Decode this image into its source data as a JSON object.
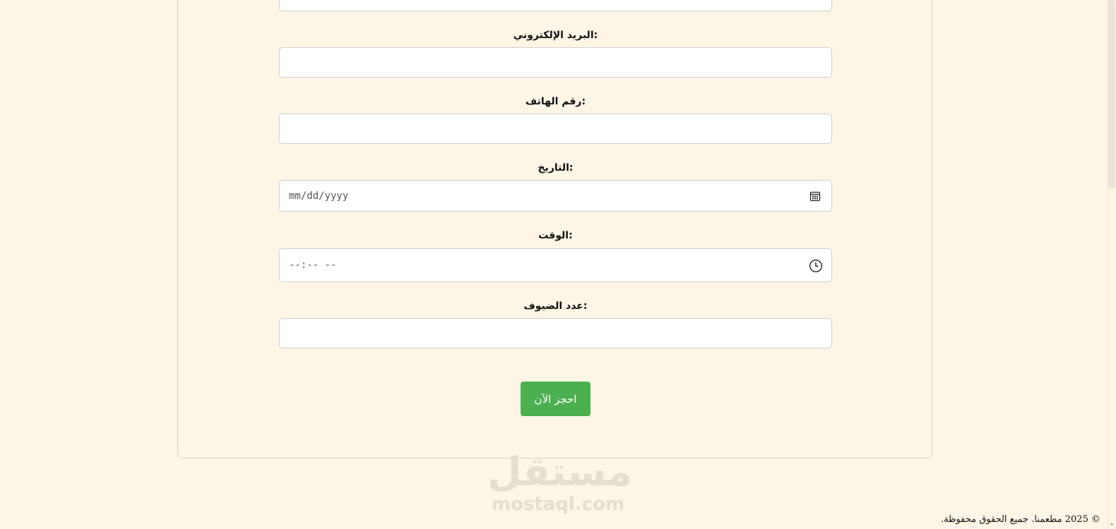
{
  "form": {
    "fields": [
      {
        "label": "البريد الإلكتروني:",
        "value": ""
      },
      {
        "label": "رقم الهاتف:",
        "value": ""
      },
      {
        "label": "التاريخ:",
        "value": "mm/dd/yyyy"
      },
      {
        "label": "الوقت:",
        "value": "--:-- --"
      },
      {
        "label": "عدد الضيوف:",
        "value": ""
      }
    ],
    "submit_label": "احجز الآن"
  },
  "watermark": {
    "arabic": "مستقل",
    "latin": "mostaql.com"
  },
  "footer": {
    "text": "© 2025 مطعمنا. جميع الحقوق محفوظة."
  },
  "colors": {
    "background": "#fdf5e6",
    "accent": "#4caf50",
    "input_border": "#cfcfcf"
  },
  "icons": {
    "date": "calendar-icon",
    "time": "clock-icon"
  }
}
